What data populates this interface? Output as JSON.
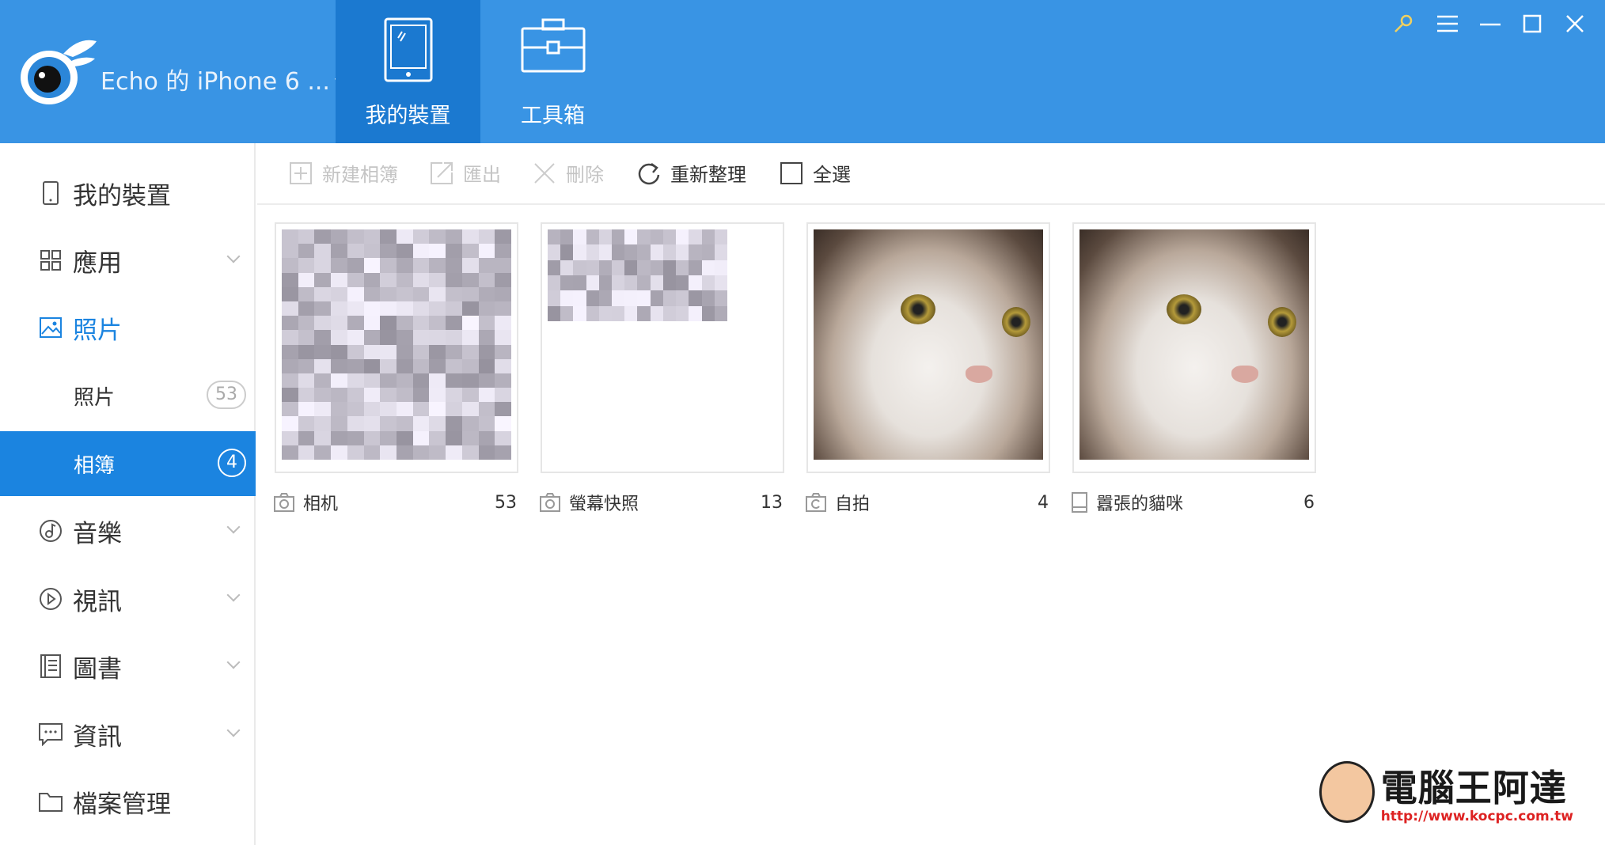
{
  "header": {
    "device_name": "Echo 的 iPhone 6 ...",
    "device_caret": "▼",
    "tabs": [
      {
        "label": "我的裝置",
        "icon": "phone-icon",
        "active": true
      },
      {
        "label": "工具箱",
        "icon": "toolbox-icon",
        "active": false
      }
    ],
    "window_buttons": [
      "pin-icon",
      "menu-icon",
      "minimize-icon",
      "maximize-icon",
      "close-icon"
    ]
  },
  "sidebar": {
    "items": [
      {
        "label": "我的裝置",
        "icon": "phone-icon"
      },
      {
        "label": "應用",
        "icon": "apps-icon",
        "expandable": true
      },
      {
        "label": "照片",
        "icon": "photo-icon",
        "accent": true
      },
      {
        "label": "照片",
        "sub": true,
        "badge": "53"
      },
      {
        "label": "相簿",
        "sub": true,
        "badge": "4",
        "selected": true
      },
      {
        "label": "音樂",
        "icon": "music-icon",
        "expandable": true
      },
      {
        "label": "視訊",
        "icon": "video-icon",
        "expandable": true
      },
      {
        "label": "圖書",
        "icon": "book-icon",
        "expandable": true
      },
      {
        "label": "資訊",
        "icon": "message-icon",
        "expandable": true
      },
      {
        "label": "檔案管理",
        "icon": "folder-icon"
      }
    ]
  },
  "toolbar": {
    "new_album": "新建相簿",
    "export": "匯出",
    "delete": "刪除",
    "refresh": "重新整理",
    "select_all": "全選"
  },
  "albums": [
    {
      "name": "相机",
      "count": "53",
      "icon": "camera-icon"
    },
    {
      "name": "螢幕快照",
      "count": "13",
      "icon": "camera-icon"
    },
    {
      "name": "自拍",
      "count": "4",
      "icon": "selfie-camera-icon"
    },
    {
      "name": "囂張的貓咪",
      "count": "6",
      "icon": "phone-album-icon"
    }
  ],
  "watermark": {
    "title": "電腦王阿達",
    "url": "http://www.kocpc.com.tw"
  },
  "colors": {
    "header": "#3994e4",
    "active_tab": "#1b79d0",
    "accent": "#1b84e0"
  }
}
